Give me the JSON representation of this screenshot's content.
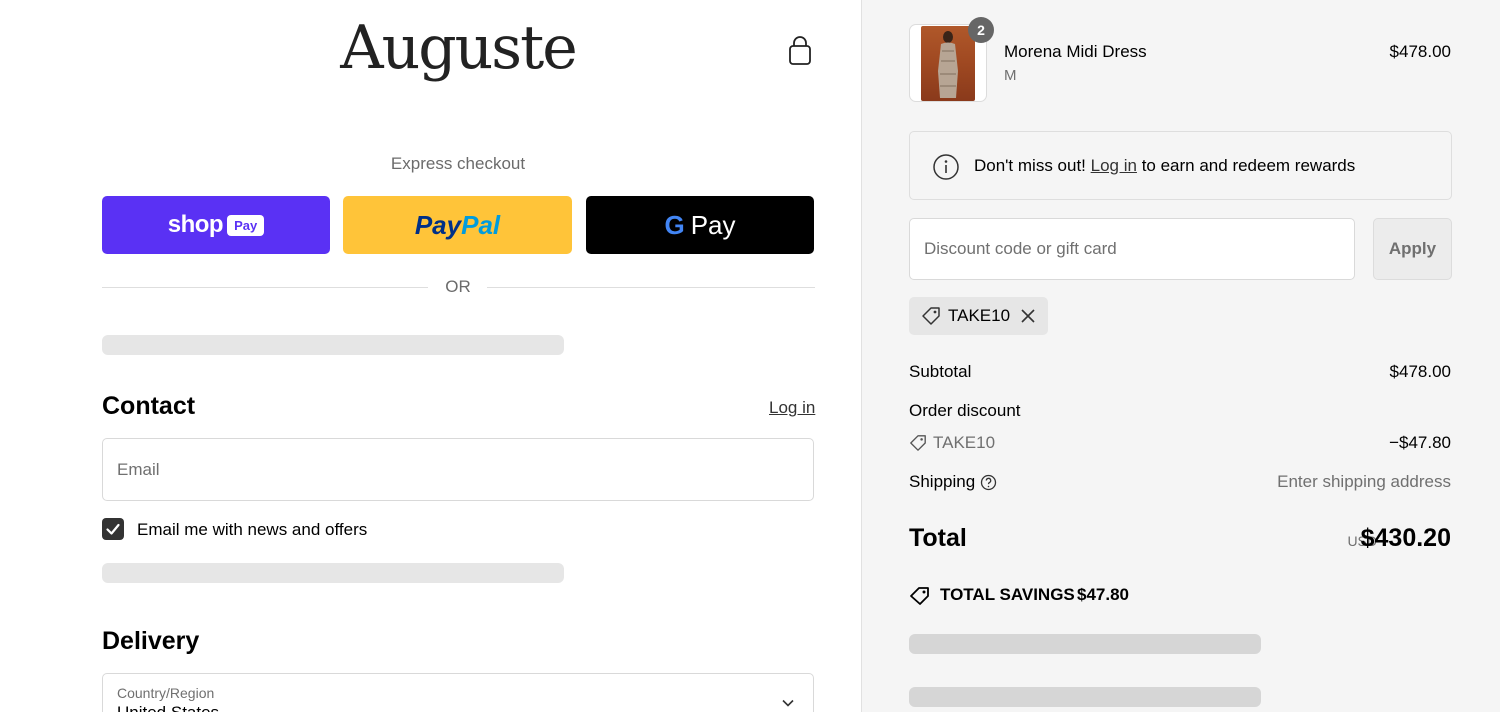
{
  "store": {
    "name": "Auguste"
  },
  "express": {
    "label": "Express checkout",
    "shop_pay": {
      "word": "shop",
      "badge": "Pay"
    },
    "paypal": {
      "part1": "Pay",
      "part2": "Pal"
    },
    "gpay": {
      "g": "G",
      "word": "Pay"
    },
    "or_text": "OR"
  },
  "contact": {
    "title": "Contact",
    "login_label": "Log in",
    "email_placeholder": "Email",
    "marketing_label": "Email me with news and offers",
    "marketing_checked": true
  },
  "delivery": {
    "title": "Delivery",
    "country_label": "Country/Region",
    "country_value": "United States"
  },
  "order": {
    "item": {
      "name": "Morena Midi Dress",
      "variant": "M",
      "price": "$478.00",
      "quantity": "2"
    },
    "rewards": {
      "prefix": "Don't miss out!",
      "link": "Log in",
      "suffix": "to earn and redeem rewards"
    },
    "discount": {
      "placeholder": "Discount code or gift card",
      "apply_label": "Apply",
      "applied_code": "TAKE10"
    },
    "summary": {
      "subtotal_label": "Subtotal",
      "subtotal_value": "$478.00",
      "order_discount_label": "Order discount",
      "discount_code": "TAKE10",
      "discount_value": "−$47.80",
      "shipping_label": "Shipping",
      "shipping_value": "Enter shipping address",
      "total_label": "Total",
      "total_currency": "USD",
      "total_value": "$430.20",
      "savings_label": "TOTAL SAVINGS",
      "savings_value": "$47.80"
    }
  },
  "colors": {
    "shop_pay": "#5a31f4",
    "paypal": "#ffc439",
    "gpay": "#000000",
    "sidebar_bg": "#f5f5f5"
  }
}
